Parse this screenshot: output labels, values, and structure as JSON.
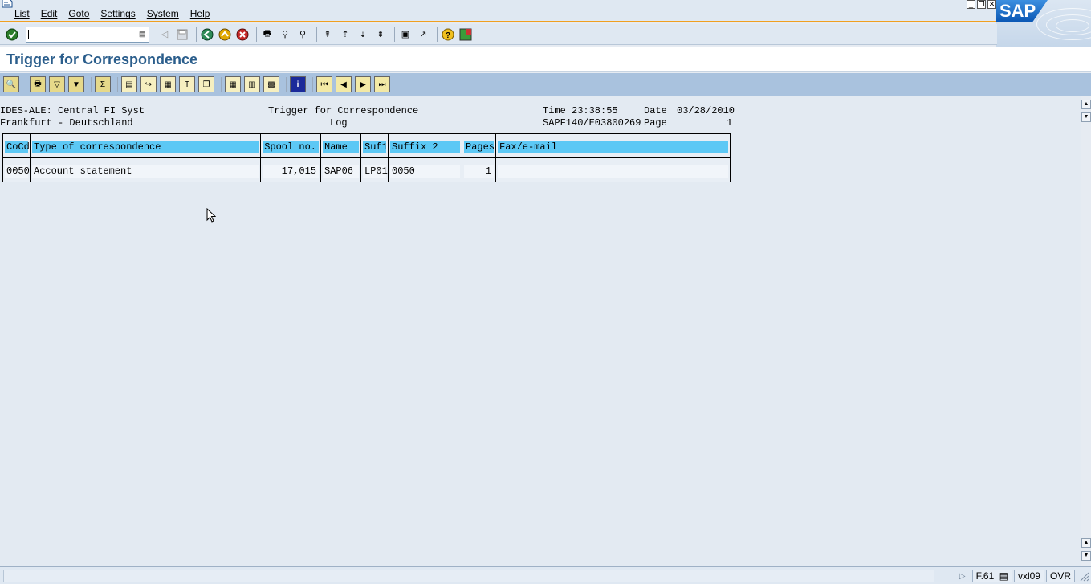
{
  "menu": [
    "List",
    "Edit",
    "Goto",
    "Settings",
    "System",
    "Help"
  ],
  "command_field": {
    "value": ""
  },
  "title": "Trigger for Correspondence",
  "sap_logo_text": "SAP",
  "report_header": {
    "line1_left": "IDES-ALE: Central FI Syst",
    "line1_center": "Trigger for Correspondence",
    "line1_time_label": "Time",
    "line1_time": "23:38:55",
    "line1_date_label": "Date",
    "line1_date": "03/28/2010",
    "line2_left": "Frankfurt - Deutschland",
    "line2_center": "Log",
    "line2_program": "SAPF140/E03800269",
    "line2_page_label": "Page",
    "line2_page": "1"
  },
  "table": {
    "headers": {
      "cocd": "CoCd",
      "type": "Type of correspondence",
      "spool": "Spool no.",
      "name": "Name",
      "suf1": "Suf1",
      "suffix2": "Suffix 2",
      "pages": "Pages",
      "fax": "Fax/e-mail"
    },
    "rows": [
      {
        "cocd": "0050",
        "type": "Account statement",
        "spool": "17,015",
        "name": "SAP06",
        "suf1": "LP01",
        "suffix2": "0050",
        "pages": "1",
        "fax": ""
      }
    ]
  },
  "status": {
    "transaction": "F.61",
    "server": "vxl09",
    "mode": "OVR"
  }
}
